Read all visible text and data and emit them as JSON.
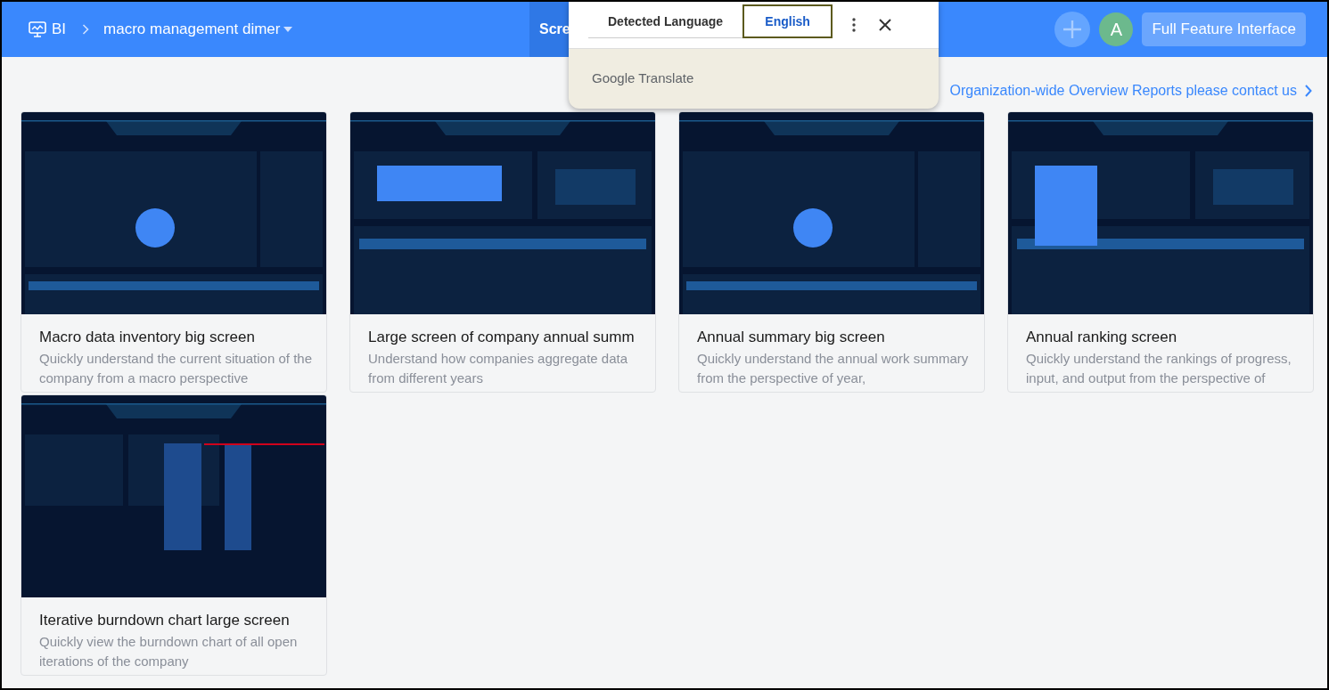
{
  "header": {
    "app": "BI",
    "breadcrumb": "macro management dimer",
    "tab": "Scre",
    "full_button": "Full Feature Interface",
    "avatar": "A"
  },
  "translate_popup": {
    "tabs": [
      {
        "label": "Detected Language",
        "selected": false
      },
      {
        "label": "English",
        "selected": true
      }
    ],
    "brand": "Google Translate"
  },
  "contact_link": "Organization-wide Overview Reports please contact us",
  "cards": [
    {
      "kind": "picture",
      "title": "Macro data inventory big screen",
      "description": "Quickly understand the current situation of the company from a macro perspective"
    },
    {
      "kind": "picture",
      "title": "Large screen of company annual summ",
      "description": "Understand how companies aggregate data from different years"
    },
    {
      "kind": "picture",
      "title": "Annual summary big screen",
      "description": "Quickly understand the annual work summary from the perspective of year,"
    },
    {
      "kind": "picture",
      "title": "Annual ranking screen",
      "description": "Quickly understand the rankings of progress, input, and output from the perspective of"
    },
    {
      "kind": "picture",
      "title": "Iterative burndown chart large screen",
      "description": "Quickly view the burndown chart of all open iterations of the company"
    }
  ]
}
